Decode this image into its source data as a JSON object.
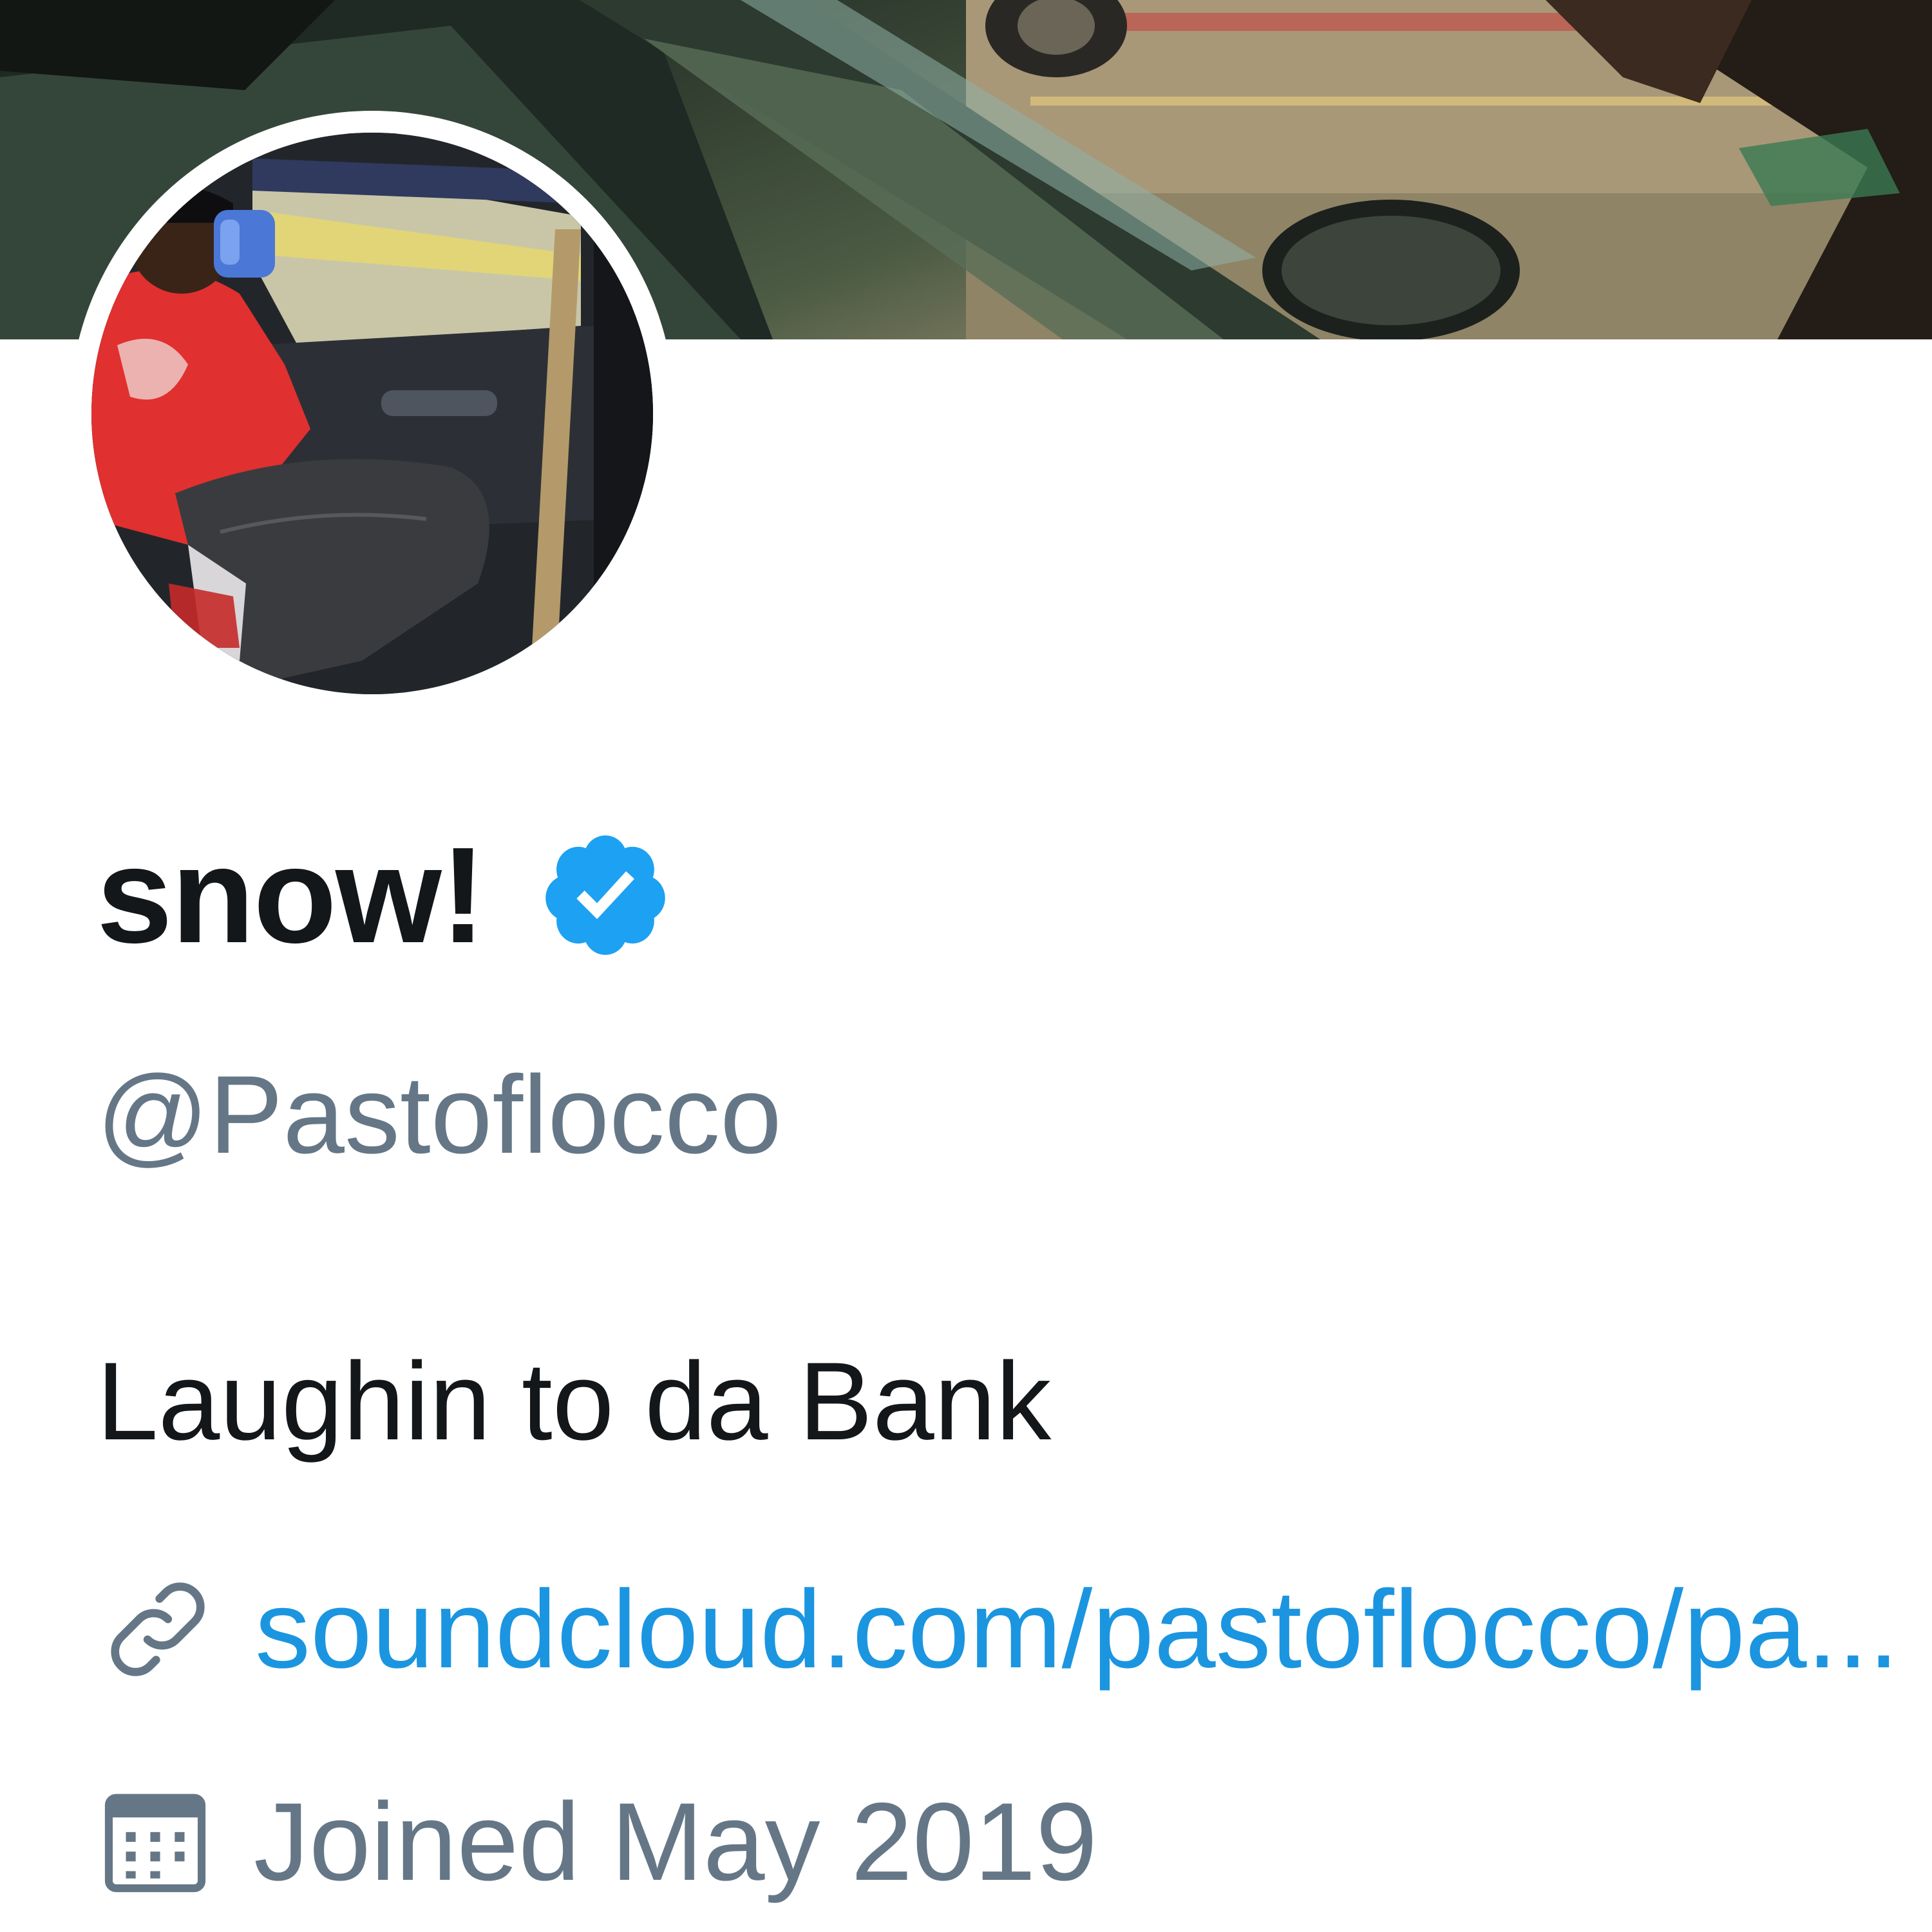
{
  "profile": {
    "display_name": "snow!",
    "handle": "@Pastoflocco",
    "bio": "Laughin to da Bank",
    "website": "soundcloud.com/pastoflocco/pa...",
    "joined": "Joined May 2019",
    "verified": true
  },
  "icons": {
    "verified": "verified-badge-icon",
    "link": "link-icon",
    "calendar": "calendar-icon"
  },
  "colors": {
    "name_text": "#14171a",
    "secondary_text": "#657786",
    "link": "#1b95e0",
    "verified_badge": "#1da1f2"
  }
}
